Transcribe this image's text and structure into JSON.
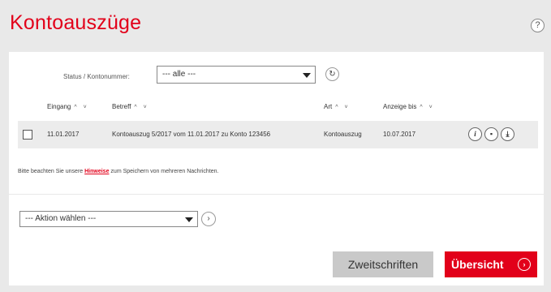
{
  "page": {
    "title": "Kontoauszüge",
    "help_label": "?"
  },
  "filter": {
    "label": "Status / Kontonummer:",
    "selected": "--- alle ---"
  },
  "table": {
    "headers": [
      "Eingang",
      "Betreff",
      "Art",
      "Anzeige bis"
    ],
    "sort_symbol": "^ ˅",
    "rows": [
      {
        "eingang": "11.01.2017",
        "betreff": "Kontoauszug 5/2017 vom 11.01.2017 zu Konto 123456",
        "art": "Kontoauszug",
        "anzeige_bis": "10.07.2017"
      }
    ]
  },
  "hint": {
    "before": "Bitte beachten Sie unsere ",
    "link": "Hinweise",
    "after": " zum Speichern von mehreren Nachrichten."
  },
  "action": {
    "selected": "--- Aktion wählen ---"
  },
  "buttons": {
    "secondary": "Zweitschriften",
    "primary": "Übersicht"
  },
  "colors": {
    "brand": "#e2001a",
    "panel": "#ffffff",
    "row": "#ececec"
  },
  "icons": [
    "help-icon",
    "refresh-icon",
    "info-icon",
    "delete-icon",
    "download-icon",
    "chevron-right-icon"
  ]
}
